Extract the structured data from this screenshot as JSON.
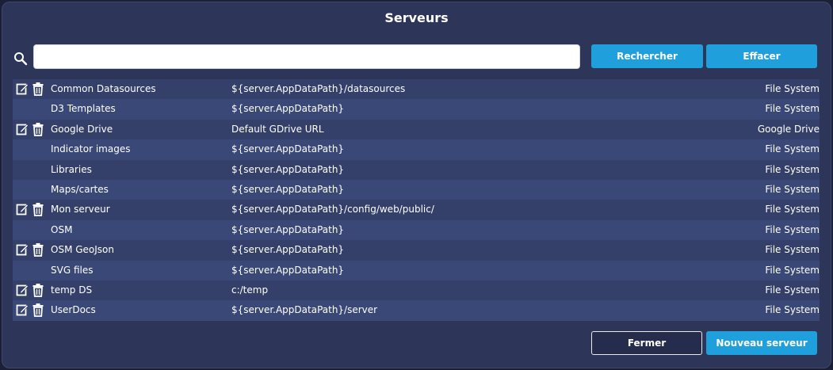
{
  "dialog": {
    "title": "Serveurs"
  },
  "search": {
    "placeholder": "",
    "value": "",
    "search_label": "Rechercher",
    "clear_label": "Effacer"
  },
  "footer": {
    "close_label": "Fermer",
    "new_label": "Nouveau serveur"
  },
  "icons": {
    "search": "search-icon",
    "edit": "edit-icon",
    "delete": "trash-icon"
  },
  "colors": {
    "accent": "#1fa0dc",
    "panel": "#2d3558",
    "row_odd": "#34406a",
    "row_even": "#3a4877"
  },
  "servers": [
    {
      "name": "Common Datasources",
      "path": "${server.AppDataPath}/datasources",
      "type": "File System",
      "editable": true
    },
    {
      "name": "D3 Templates",
      "path": "${server.AppDataPath}",
      "type": "File System",
      "editable": false
    },
    {
      "name": "Google Drive",
      "path": "Default GDrive URL",
      "type": "Google Drive",
      "editable": true
    },
    {
      "name": "Indicator images",
      "path": "${server.AppDataPath}",
      "type": "File System",
      "editable": false
    },
    {
      "name": "Libraries",
      "path": "${server.AppDataPath}",
      "type": "File System",
      "editable": false
    },
    {
      "name": "Maps/cartes",
      "path": "${server.AppDataPath}",
      "type": "File System",
      "editable": false
    },
    {
      "name": "Mon serveur",
      "path": "${server.AppDataPath}/config/web/public/",
      "type": "File System",
      "editable": true
    },
    {
      "name": "OSM",
      "path": "${server.AppDataPath}",
      "type": "File System",
      "editable": false
    },
    {
      "name": "OSM GeoJson",
      "path": "${server.AppDataPath}",
      "type": "File System",
      "editable": true
    },
    {
      "name": "SVG files",
      "path": "${server.AppDataPath}",
      "type": "File System",
      "editable": false
    },
    {
      "name": "temp DS",
      "path": "c:/temp",
      "type": "File System",
      "editable": true
    },
    {
      "name": "UserDocs",
      "path": "${server.AppDataPath}/server",
      "type": "File System",
      "editable": true
    }
  ]
}
